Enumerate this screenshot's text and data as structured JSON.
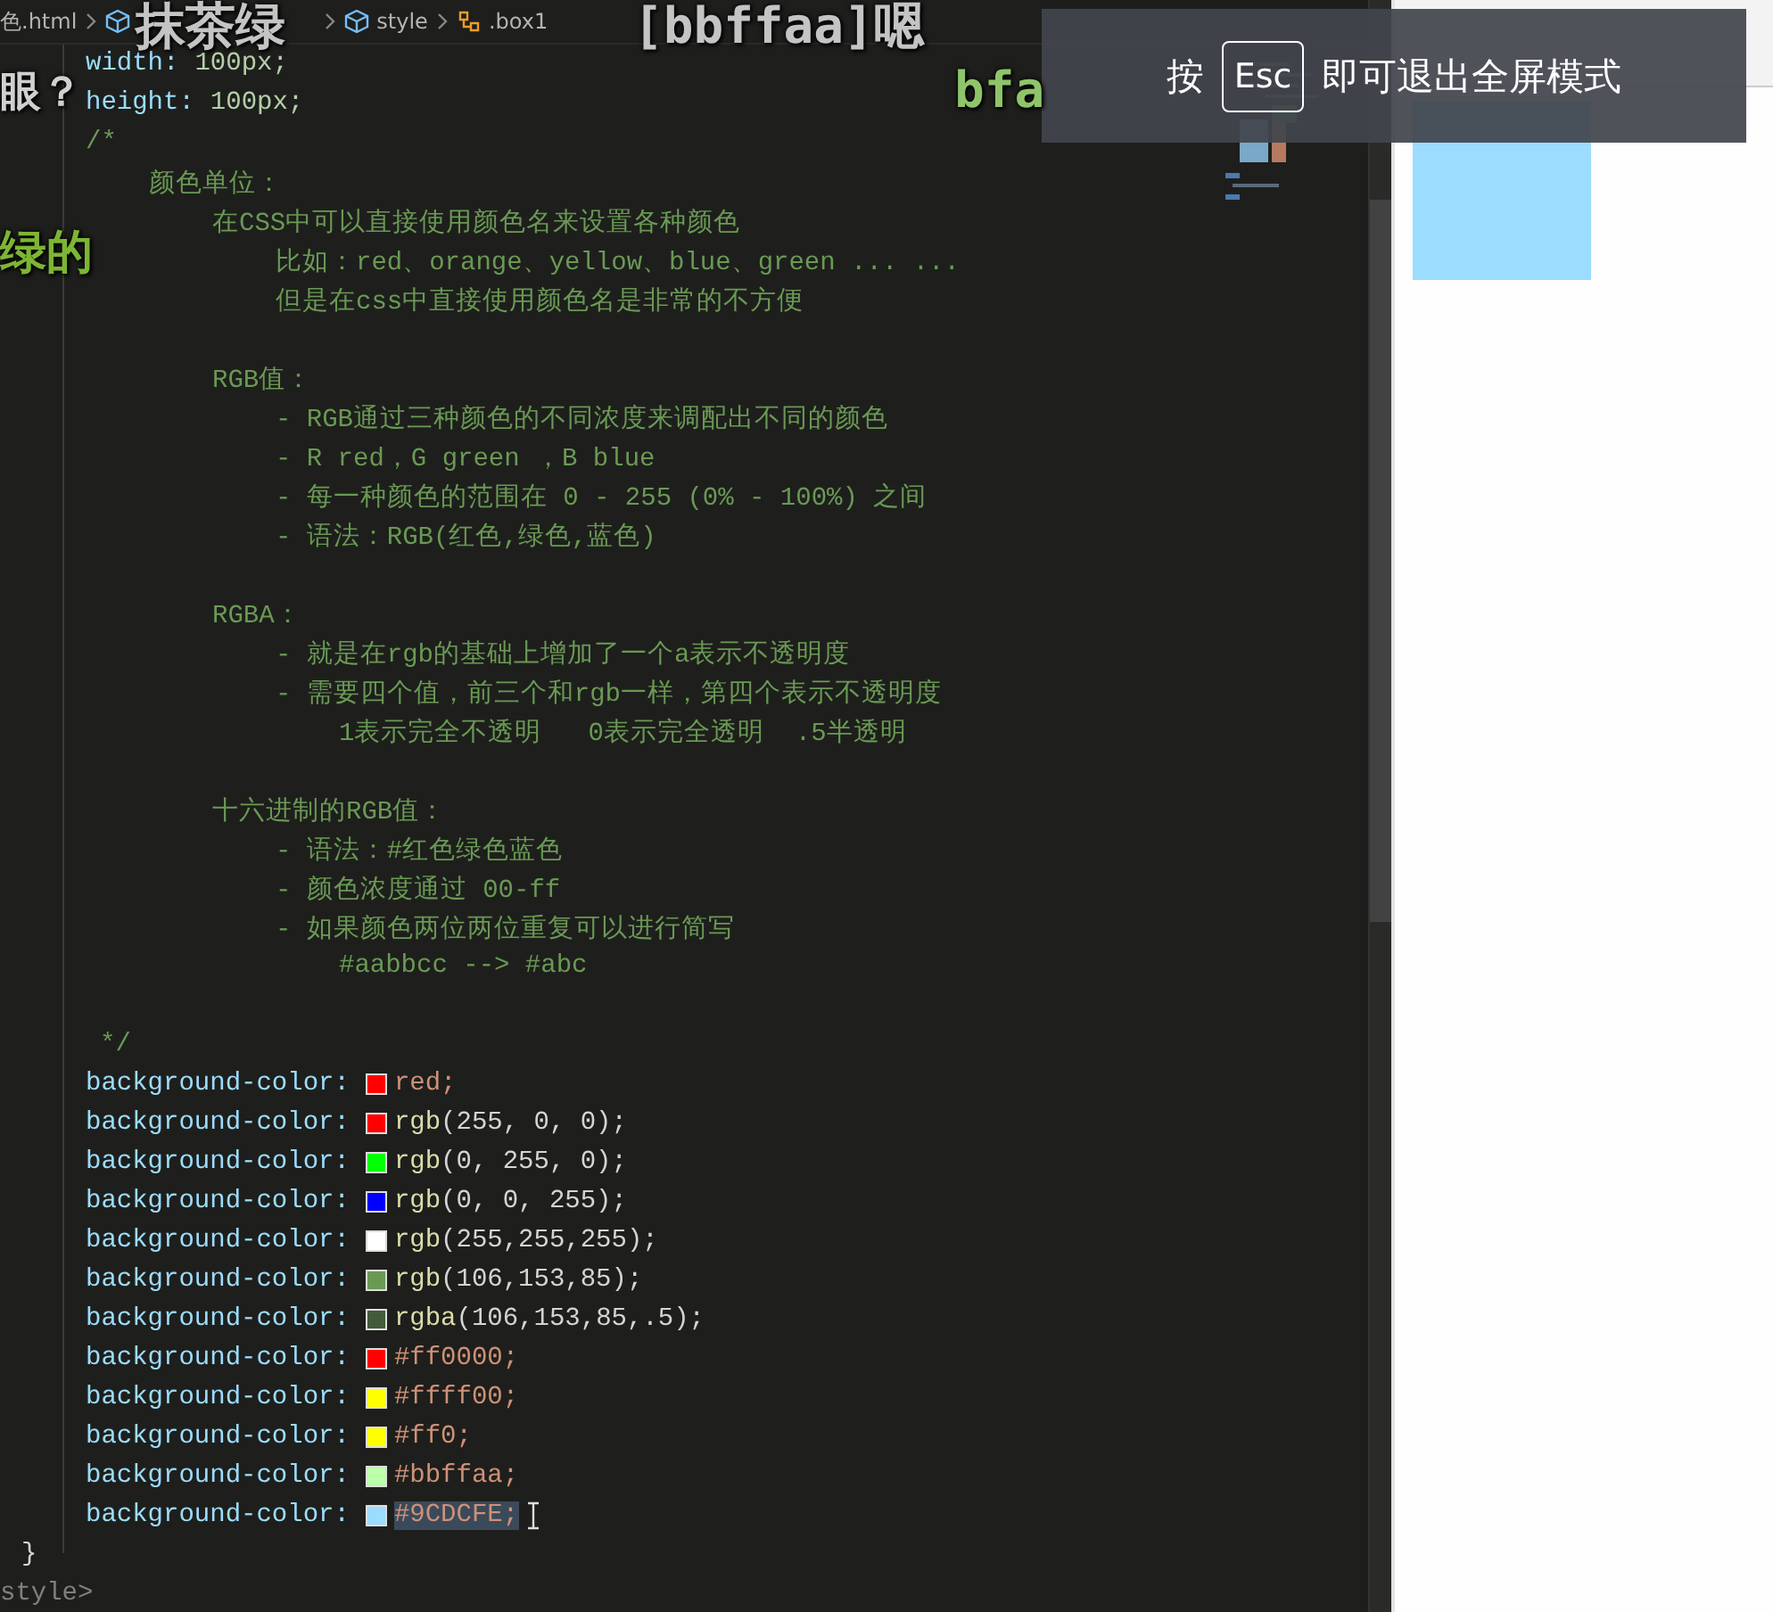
{
  "breadcrumb": [
    {
      "label": "色.html"
    },
    {
      "label": "style"
    },
    {
      "label": ".box1"
    }
  ],
  "code_lines": [
    {
      "kind": "dimension",
      "property": "width:",
      "value": "100px;"
    },
    {
      "kind": "dimension",
      "property": "height:",
      "value": "100px;"
    },
    {
      "kind": "comment",
      "text": "/*",
      "children": [
        {
          "kind": "comment",
          "text": "颜色单位：",
          "children": [
            {
              "kind": "comment",
              "text": "在CSS中可以直接使用颜色名来设置各种颜色",
              "children": [
                {
                  "kind": "comment",
                  "text": "比如：red、orange、yellow、blue、green ... ..."
                },
                {
                  "kind": "comment",
                  "text": "但是在css中直接使用颜色名是非常的不方便"
                }
              ]
            },
            {
              "kind": "blank"
            },
            {
              "kind": "comment",
              "text": "RGB值：",
              "children": [
                {
                  "kind": "comment",
                  "text": "- RGB通过三种颜色的不同浓度来调配出不同的颜色"
                },
                {
                  "kind": "comment",
                  "text": "- R red，G green ，B blue"
                },
                {
                  "kind": "comment",
                  "text": "- 每一种颜色的范围在 0 - 255 (0% - 100%) 之间"
                },
                {
                  "kind": "comment",
                  "text": "- 语法：RGB(红色,绿色,蓝色)"
                }
              ]
            },
            {
              "kind": "blank"
            },
            {
              "kind": "comment",
              "text": "RGBA：",
              "children": [
                {
                  "kind": "comment",
                  "text": "- 就是在rgb的基础上增加了一个a表示不透明度"
                },
                {
                  "kind": "comment",
                  "text": "- 需要四个值，前三个和rgb一样，第四个表示不透明度",
                  "children": [
                    {
                      "kind": "comment",
                      "text": "1表示完全不透明   0表示完全透明  .5半透明"
                    }
                  ]
                }
              ]
            },
            {
              "kind": "blank"
            },
            {
              "kind": "comment",
              "text": "十六进制的RGB值：",
              "children": [
                {
                  "kind": "comment",
                  "text": "- 语法：#红色绿色蓝色"
                },
                {
                  "kind": "comment",
                  "text": "- 颜色浓度通过 00-ff"
                },
                {
                  "kind": "comment",
                  "text": "- 如果颜色两位两位重复可以进行简写",
                  "children": [
                    {
                      "kind": "comment",
                      "text": "#aabbcc --> #abc"
                    }
                  ]
                }
              ]
            },
            {
              "kind": "blank"
            }
          ]
        }
      ]
    },
    {
      "kind": "comment_end",
      "text": "*/"
    },
    {
      "kind": "declaration",
      "property": "background-color:",
      "color": "#ff0000",
      "value": "red;",
      "selected": false
    },
    {
      "kind": "declaration",
      "property": "background-color:",
      "color": "#ff0000",
      "function": "rgb",
      "args": "(255, 0, 0);",
      "selected": false
    },
    {
      "kind": "declaration",
      "property": "background-color:",
      "color": "#00ff00",
      "function": "rgb",
      "args": "(0, 255, 0);",
      "selected": false
    },
    {
      "kind": "declaration",
      "property": "background-color:",
      "color": "#0000ff",
      "function": "rgb",
      "args": "(0, 0, 255);",
      "selected": false
    },
    {
      "kind": "declaration",
      "property": "background-color:",
      "color": "#ffffff",
      "function": "rgb",
      "args": "(255,255,255);",
      "selected": false
    },
    {
      "kind": "declaration",
      "property": "background-color:",
      "color": "#6a9955",
      "function": "rgb",
      "args": "(106,153,85);",
      "selected": false
    },
    {
      "kind": "declaration",
      "property": "background-color:",
      "color": "#445a3a",
      "function": "rgba",
      "args": "(106,153,85,.5);",
      "selected": false
    },
    {
      "kind": "declaration",
      "property": "background-color:",
      "color": "#ff0000",
      "value": "#ff0000;",
      "selected": false
    },
    {
      "kind": "declaration",
      "property": "background-color:",
      "color": "#ffff00",
      "value": "#ffff00;",
      "selected": false
    },
    {
      "kind": "declaration",
      "property": "background-color:",
      "color": "#ffff00",
      "value": "#ff0;",
      "selected": false
    },
    {
      "kind": "declaration",
      "property": "background-color:",
      "color": "#bbffaa",
      "value": "#bbffaa;",
      "selected": false
    },
    {
      "kind": "declaration",
      "property": "background-color:",
      "color": "#9cdcfe",
      "value": "#9CDCFE;",
      "selected": true
    },
    {
      "kind": "brace",
      "text": "}"
    },
    {
      "kind": "tag",
      "text": "style>"
    }
  ],
  "fullscreen_notice": {
    "prefix": "按",
    "key": "Esc",
    "suffix": "即可退出全屏模式"
  },
  "comments_overlay": [
    {
      "text": "抹茶绿",
      "color": "#c4c4c4"
    },
    {
      "text": "[bbffaa]嗯",
      "color": "#c4c4c4"
    },
    {
      "text": "眼？",
      "color": "#d0d0d0"
    },
    {
      "text": "bfa",
      "color": "#8fc46a"
    },
    {
      "text": "绿的",
      "color": "#7db534"
    }
  ]
}
